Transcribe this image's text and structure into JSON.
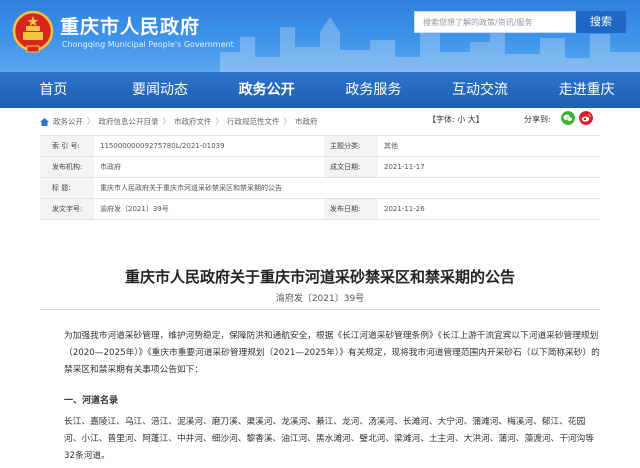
{
  "header": {
    "title": "重庆市人民政府",
    "subtitle": "Chongqing Municipal People's Government",
    "search_placeholder": "搜索您想了解的政策/资讯/服务",
    "search_button": "搜索"
  },
  "nav": {
    "items": [
      "首页",
      "要闻动态",
      "政务公开",
      "政务服务",
      "互动交流",
      "走进重庆"
    ],
    "active_index": 2
  },
  "breadcrumb": [
    "政务公开",
    "政府信息公开目录",
    "市政府文件",
    "行政规范性文件",
    "市政府"
  ],
  "font_size": {
    "label": "【字体:",
    "small": "小",
    "large": "大",
    "close": "】"
  },
  "share": {
    "label": "分享到:",
    "icons": [
      "wechat-icon",
      "weibo-icon"
    ]
  },
  "info": {
    "index_label": "索 引 号:",
    "index_value": "11500000009275780L/2021-01039",
    "category_label": "主题分类:",
    "category_value": "其他",
    "issuer_label": "发布机构:",
    "issuer_value": "市政府",
    "date_made_label": "成文日期:",
    "date_made_value": "2021-11-17",
    "title_label": "标    题:",
    "title_value": "重庆市人民政府关于重庆市河道采砂禁采区和禁采期的公告",
    "doc_no_label": "发文字号:",
    "doc_no_value": "渝府发〔2021〕39号",
    "pub_date_label": "发布日期:",
    "pub_date_value": "2021-11-26"
  },
  "article": {
    "title": "重庆市人民政府关于重庆市河道采砂禁采区和禁采期的公告",
    "doc_no": "渝府发〔2021〕39号",
    "paragraph": "为加强我市河道采砂管理，维护河势稳定，保障防洪和通航安全，根据《长江河道采砂管理条例》《长江上游干流宜宾以下河道采砂管理规划（2020—2025年）》《重庆市重要河道采砂管理规划（2021—2025年）》有关规定，现将我市河道管理范围内开采砂石（以下简称采砂）的禁采区和禁采期有关事项公告如下：",
    "section1": "一、河道名录",
    "rivers": "长江、嘉陵江、乌江、涪江、泥溪河、磨刀溪、渠溪河、龙溪河、綦江、龙河、汤溪河、长滩河、大宁河、蒲滩河、梅溪河、郁江、花园河、小江、普里河、阿蓬江、中井河、细沙河、黎香溪、油江河、黑水滩河、璧北河、梁滩河、土主河、大洪河、蒲河、藻渡河、干河沟等32条河道。"
  }
}
